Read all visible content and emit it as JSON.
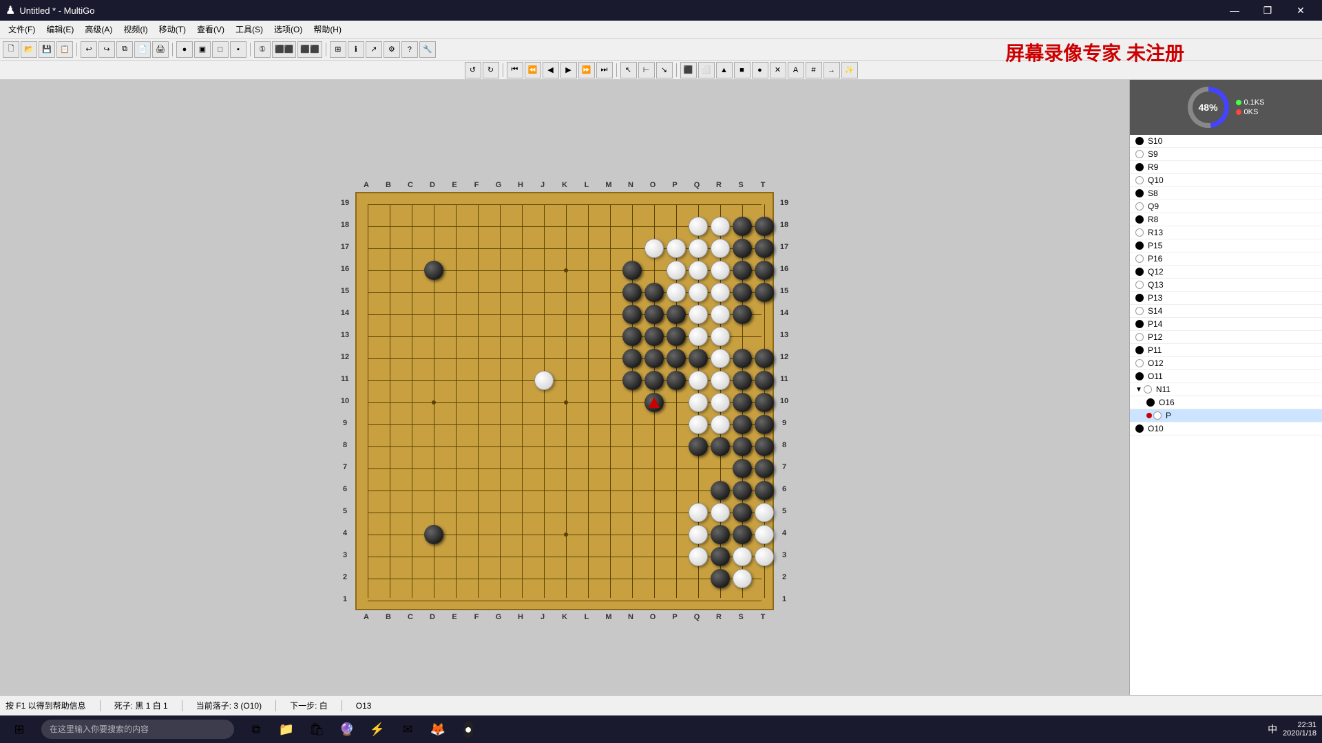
{
  "titlebar": {
    "icon": "♟",
    "title": "Untitled * - MultiGo",
    "min": "—",
    "max": "❐",
    "close": "✕"
  },
  "menubar": {
    "items": [
      "文件(F)",
      "编辑(E)",
      "高级(A)",
      "视频(I)",
      "移动(T)",
      "查看(V)",
      "工具(S)",
      "选项(O)",
      "帮助(H)"
    ]
  },
  "watermark": "屏幕录像专家  未注册",
  "board": {
    "cols": [
      "A",
      "B",
      "C",
      "D",
      "E",
      "F",
      "G",
      "H",
      "J",
      "K",
      "L",
      "M",
      "N",
      "O",
      "P",
      "Q",
      "R",
      "S",
      "T"
    ],
    "rows": [
      "19",
      "18",
      "17",
      "16",
      "15",
      "14",
      "13",
      "12",
      "11",
      "10",
      "9",
      "8",
      "7",
      "6",
      "5",
      "4",
      "3",
      "2",
      "1"
    ]
  },
  "gauge": {
    "percent": "48%",
    "stat1_label": "0.1KS",
    "stat2_label": "0KS"
  },
  "moves": [
    {
      "color": "black",
      "label": "S10"
    },
    {
      "color": "white",
      "label": "S9"
    },
    {
      "color": "black",
      "label": "R9"
    },
    {
      "color": "white",
      "label": "Q10"
    },
    {
      "color": "black",
      "label": "S8"
    },
    {
      "color": "white",
      "label": "Q9"
    },
    {
      "color": "black",
      "label": "R8"
    },
    {
      "color": "white",
      "label": "R13"
    },
    {
      "color": "black",
      "label": "P15"
    },
    {
      "color": "white",
      "label": "P16"
    },
    {
      "color": "black",
      "label": "Q12"
    },
    {
      "color": "white",
      "label": "Q13"
    },
    {
      "color": "black",
      "label": "P13"
    },
    {
      "color": "white",
      "label": "S14"
    },
    {
      "color": "black",
      "label": "P14"
    },
    {
      "color": "white",
      "label": "P12"
    },
    {
      "color": "black",
      "label": "P11"
    },
    {
      "color": "white",
      "label": "O12"
    },
    {
      "color": "black",
      "label": "O11"
    },
    {
      "color": "white",
      "label": "N11",
      "expand": true
    },
    {
      "color": "black",
      "label": "O16",
      "indent": true
    },
    {
      "color": "white",
      "label": "P",
      "indent": true,
      "active": true
    },
    {
      "color": "black",
      "label": "O10"
    }
  ],
  "statusbar": {
    "help": "按 F1 以得到帮助信息",
    "dead": "死子: 黑 1 白 1",
    "current": "当前落子: 3 (O10)",
    "next": "下一步: 白",
    "coord": "O13"
  },
  "taskbar": {
    "search_placeholder": "在这里输入你要搜索的内容",
    "time": "22:31",
    "date": "2020/1/18",
    "lang": "中"
  }
}
